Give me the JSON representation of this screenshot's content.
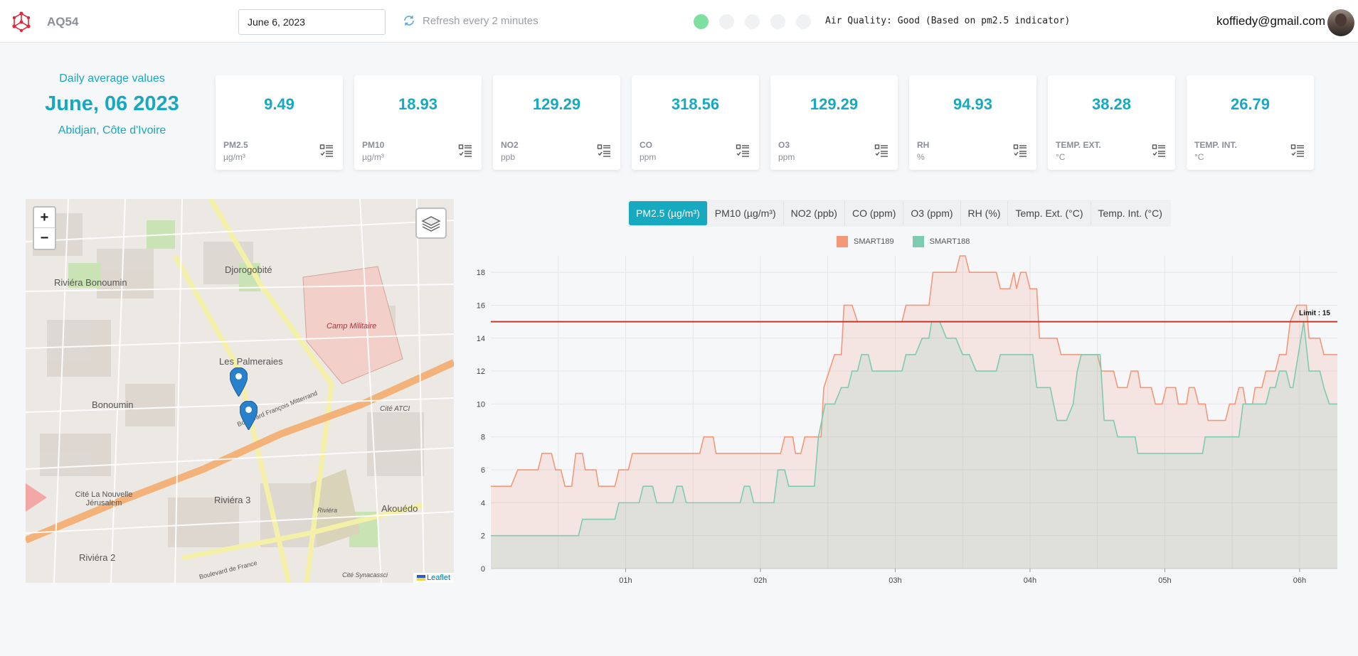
{
  "header": {
    "app_name": "AQ54",
    "date_value": "June 6, 2023",
    "refresh_label": "Refresh every 2 minutes",
    "quality_levels": [
      {
        "level": "Good",
        "active": true,
        "color": "#7ee0a0"
      },
      {
        "level": "2",
        "active": false,
        "color": "#f0f1f3"
      },
      {
        "level": "3",
        "active": false,
        "color": "#f0f1f3"
      },
      {
        "level": "4",
        "active": false,
        "color": "#f0f1f3"
      },
      {
        "level": "5",
        "active": false,
        "color": "#f0f1f3"
      }
    ],
    "air_quality_text": "Air Quality: Good (Based on pm2.5 indicator)",
    "user_email": "koffiedy@gmail.com"
  },
  "summary": {
    "label": "Daily average values",
    "date": "June, 06 2023",
    "location": "Abidjan, Côte d'Ivoire"
  },
  "cards": [
    {
      "value": "9.49",
      "name": "PM2.5",
      "unit": "µg/m³"
    },
    {
      "value": "18.93",
      "name": "PM10",
      "unit": "µg/m³"
    },
    {
      "value": "129.29",
      "name": "NO2",
      "unit": "ppb"
    },
    {
      "value": "318.56",
      "name": "CO",
      "unit": "ppm"
    },
    {
      "value": "129.29",
      "name": "O3",
      "unit": "ppm"
    },
    {
      "value": "94.93",
      "name": "RH",
      "unit": "%"
    },
    {
      "value": "38.28",
      "name": "TEMP. EXT.",
      "unit": "°C"
    },
    {
      "value": "26.79",
      "name": "TEMP. INT.",
      "unit": "°C"
    }
  ],
  "map": {
    "zoom_in": "+",
    "zoom_out": "−",
    "attribution": "Leaflet",
    "labels": [
      "Riviéra Bonoumin",
      "Djorogobité",
      "Camp Militaire",
      "Les Palmeraies",
      "Bonoumin",
      "Cité ATCI",
      "Riviéra 3",
      "Akouédo",
      "Cité La Nouvelle Jérusalem",
      "Riviéra 2",
      "Boulevard François Mitterrand",
      "Boulevard de France",
      "Cité Synacassci",
      "Riviéra"
    ]
  },
  "tabs": [
    {
      "label": "PM2.5 (µg/m³)",
      "active": true
    },
    {
      "label": "PM10 (µg/m³)",
      "active": false
    },
    {
      "label": "NO2 (ppb)",
      "active": false
    },
    {
      "label": "CO (ppm)",
      "active": false
    },
    {
      "label": "O3 (ppm)",
      "active": false
    },
    {
      "label": "RH (%)",
      "active": false
    },
    {
      "label": "Temp. Ext. (°C)",
      "active": false
    },
    {
      "label": "Temp. Int. (°C)",
      "active": false
    }
  ],
  "chart_data": {
    "type": "area",
    "x_range": [
      0,
      6.28
    ],
    "x_ticks": [
      {
        "v": 1,
        "label": "01h"
      },
      {
        "v": 2,
        "label": "02h"
      },
      {
        "v": 3,
        "label": "03h"
      },
      {
        "v": 4,
        "label": "04h"
      },
      {
        "v": 5,
        "label": "05h"
      },
      {
        "v": 6,
        "label": "06h"
      }
    ],
    "ylim": [
      0,
      19
    ],
    "y_ticks": [
      0,
      2,
      4,
      6,
      8,
      10,
      12,
      14,
      16,
      18
    ],
    "grid": true,
    "legend_position": "top-center",
    "limit": {
      "value": 15,
      "label": "Limit : 15",
      "color": "#c0392b"
    },
    "series": [
      {
        "name": "SMART189",
        "color": "#f4977a",
        "points": [
          [
            0,
            5
          ],
          [
            0.15,
            5
          ],
          [
            0.2,
            6
          ],
          [
            0.35,
            6
          ],
          [
            0.38,
            7
          ],
          [
            0.45,
            7
          ],
          [
            0.48,
            6
          ],
          [
            0.52,
            6
          ],
          [
            0.55,
            5
          ],
          [
            0.6,
            5
          ],
          [
            0.63,
            7
          ],
          [
            0.68,
            7
          ],
          [
            0.7,
            6
          ],
          [
            0.78,
            6
          ],
          [
            0.8,
            5
          ],
          [
            0.92,
            5
          ],
          [
            0.95,
            6
          ],
          [
            1.02,
            6
          ],
          [
            1.05,
            7
          ],
          [
            1.55,
            7
          ],
          [
            1.58,
            8
          ],
          [
            1.65,
            8
          ],
          [
            1.67,
            7
          ],
          [
            2.15,
            7
          ],
          [
            2.18,
            8
          ],
          [
            2.24,
            8
          ],
          [
            2.26,
            7
          ],
          [
            2.3,
            7
          ],
          [
            2.33,
            8
          ],
          [
            2.45,
            8
          ],
          [
            2.47,
            11
          ],
          [
            2.55,
            13
          ],
          [
            2.6,
            13
          ],
          [
            2.62,
            16
          ],
          [
            2.68,
            16
          ],
          [
            2.72,
            15
          ],
          [
            3.05,
            15
          ],
          [
            3.08,
            16
          ],
          [
            3.25,
            16
          ],
          [
            3.28,
            18
          ],
          [
            3.45,
            18
          ],
          [
            3.48,
            19
          ],
          [
            3.52,
            19
          ],
          [
            3.55,
            18
          ],
          [
            3.75,
            18
          ],
          [
            3.78,
            17
          ],
          [
            3.85,
            17
          ],
          [
            3.88,
            18
          ],
          [
            3.9,
            17
          ],
          [
            3.93,
            18
          ],
          [
            3.97,
            18
          ],
          [
            4,
            17
          ],
          [
            4.05,
            17
          ],
          [
            4.07,
            14
          ],
          [
            4.2,
            14
          ],
          [
            4.23,
            13
          ],
          [
            4.5,
            13
          ],
          [
            4.53,
            12
          ],
          [
            4.62,
            12
          ],
          [
            4.65,
            11
          ],
          [
            4.72,
            11
          ],
          [
            4.75,
            12
          ],
          [
            4.8,
            12
          ],
          [
            4.82,
            11
          ],
          [
            4.9,
            11
          ],
          [
            4.93,
            10
          ],
          [
            4.98,
            10
          ],
          [
            5.01,
            11
          ],
          [
            5.08,
            11
          ],
          [
            5.1,
            10
          ],
          [
            5.16,
            10
          ],
          [
            5.18,
            11
          ],
          [
            5.22,
            11
          ],
          [
            5.25,
            10
          ],
          [
            5.3,
            10
          ],
          [
            5.32,
            9
          ],
          [
            5.45,
            9
          ],
          [
            5.48,
            10
          ],
          [
            5.52,
            10
          ],
          [
            5.55,
            11
          ],
          [
            5.58,
            11
          ],
          [
            5.6,
            10
          ],
          [
            5.65,
            10
          ],
          [
            5.67,
            11
          ],
          [
            5.72,
            11
          ],
          [
            5.75,
            12
          ],
          [
            5.82,
            12
          ],
          [
            5.85,
            13
          ],
          [
            5.9,
            13
          ],
          [
            5.93,
            15
          ],
          [
            5.98,
            16
          ],
          [
            6.05,
            16
          ],
          [
            6.07,
            14
          ],
          [
            6.15,
            14
          ],
          [
            6.18,
            13
          ],
          [
            6.28,
            13
          ]
        ]
      },
      {
        "name": "SMART188",
        "color": "#7fcbb0",
        "points": [
          [
            0,
            2
          ],
          [
            0.65,
            2
          ],
          [
            0.68,
            3
          ],
          [
            0.92,
            3
          ],
          [
            0.95,
            4
          ],
          [
            1.1,
            4
          ],
          [
            1.13,
            5
          ],
          [
            1.2,
            5
          ],
          [
            1.23,
            4
          ],
          [
            1.35,
            4
          ],
          [
            1.38,
            5
          ],
          [
            1.42,
            5
          ],
          [
            1.45,
            4
          ],
          [
            1.85,
            4
          ],
          [
            1.88,
            5
          ],
          [
            1.92,
            5
          ],
          [
            1.95,
            4
          ],
          [
            2.1,
            4
          ],
          [
            2.13,
            6
          ],
          [
            2.18,
            6
          ],
          [
            2.21,
            5
          ],
          [
            2.4,
            5
          ],
          [
            2.43,
            8
          ],
          [
            2.48,
            10
          ],
          [
            2.55,
            10
          ],
          [
            2.6,
            11
          ],
          [
            2.65,
            11
          ],
          [
            2.68,
            12
          ],
          [
            2.72,
            12
          ],
          [
            2.75,
            13
          ],
          [
            2.8,
            13
          ],
          [
            2.83,
            12
          ],
          [
            3.05,
            12
          ],
          [
            3.08,
            13
          ],
          [
            3.15,
            13
          ],
          [
            3.2,
            14
          ],
          [
            3.25,
            14
          ],
          [
            3.27,
            15
          ],
          [
            3.33,
            15
          ],
          [
            3.38,
            14
          ],
          [
            3.45,
            14
          ],
          [
            3.5,
            13
          ],
          [
            3.55,
            13
          ],
          [
            3.6,
            12
          ],
          [
            3.75,
            12
          ],
          [
            3.78,
            13
          ],
          [
            4.02,
            13
          ],
          [
            4.05,
            11
          ],
          [
            4.15,
            11
          ],
          [
            4.2,
            9
          ],
          [
            4.27,
            9
          ],
          [
            4.32,
            10
          ],
          [
            4.35,
            12
          ],
          [
            4.38,
            13
          ],
          [
            4.52,
            13
          ],
          [
            4.55,
            9
          ],
          [
            4.62,
            9
          ],
          [
            4.65,
            8
          ],
          [
            4.78,
            8
          ],
          [
            4.8,
            7
          ],
          [
            5.28,
            7
          ],
          [
            5.3,
            8
          ],
          [
            5.55,
            8
          ],
          [
            5.58,
            10
          ],
          [
            5.75,
            10
          ],
          [
            5.78,
            11
          ],
          [
            5.82,
            11
          ],
          [
            5.85,
            12
          ],
          [
            5.9,
            12
          ],
          [
            5.93,
            11
          ],
          [
            5.95,
            11
          ],
          [
            5.97,
            12
          ],
          [
            6.03,
            15
          ],
          [
            6.07,
            12
          ],
          [
            6.15,
            12
          ],
          [
            6.18,
            11
          ],
          [
            6.22,
            10
          ],
          [
            6.28,
            10
          ]
        ]
      }
    ]
  }
}
